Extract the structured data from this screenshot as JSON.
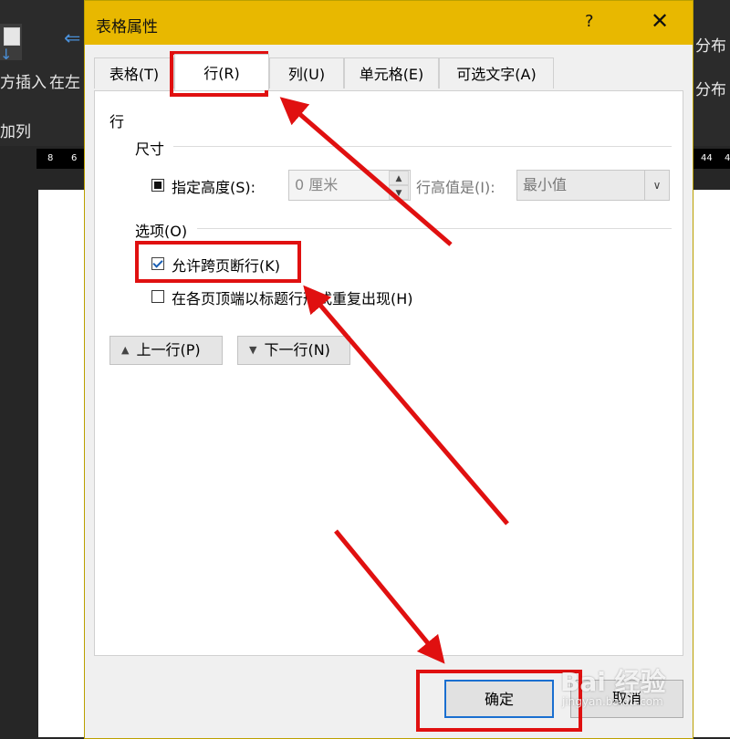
{
  "background": {
    "ribbon_left_label_1": "方插入",
    "ribbon_left_label_2": "在左",
    "ribbon_left_label_3": "加列",
    "ribbon_right_label_1": "分布",
    "ribbon_right_label_2": "分布",
    "ruler_ticks": [
      "8",
      "6",
      "44",
      "4"
    ]
  },
  "dialog": {
    "title": "表格属性",
    "help_label": "?",
    "close_label": "✕",
    "tabs": [
      {
        "label": "表格(T)",
        "active": false
      },
      {
        "label": "行(R)",
        "active": true
      },
      {
        "label": "列(U)",
        "active": false
      },
      {
        "label": "单元格(E)",
        "active": false
      },
      {
        "label": "可选文字(A)",
        "active": false
      }
    ],
    "row_section_title": "行",
    "size_group_label": "尺寸",
    "specify_height_label": "指定高度(S):",
    "specify_height_checked": true,
    "height_value": "0 厘米",
    "row_height_is_label": "行高值是(I):",
    "row_height_is_value": "最小值",
    "options_group_label": "选项(O)",
    "allow_break_label": "允许跨页断行(K)",
    "allow_break_checked": true,
    "repeat_header_label": "在各页顶端以标题行形式重复出现(H)",
    "repeat_header_checked": false,
    "prev_row_label": "上一行(P)",
    "next_row_label": "下一行(N)",
    "ok_label": "确定",
    "cancel_label": "取消"
  },
  "watermark": {
    "brand": "Bai 经验",
    "url": "jingyan.baidu.com"
  },
  "colors": {
    "title_bar": "#e8b800",
    "annotation_red": "#e01010"
  }
}
